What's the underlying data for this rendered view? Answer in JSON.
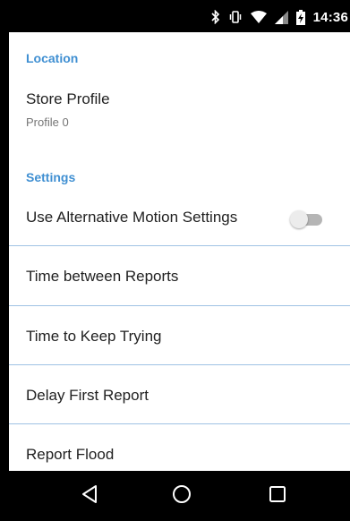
{
  "status_bar": {
    "time": "14:36",
    "icons": [
      "bluetooth-icon",
      "vibrate-icon",
      "wifi-icon",
      "cell-signal-icon",
      "battery-charging-icon"
    ]
  },
  "location_section": {
    "header": "Location",
    "store_profile": {
      "title": "Store Profile",
      "summary": "Profile 0"
    }
  },
  "settings_section": {
    "header": "Settings",
    "items": [
      {
        "title": "Use Alternative Motion Settings",
        "has_toggle": true,
        "toggle_on": false
      },
      {
        "title": "Time between Reports"
      },
      {
        "title": "Time to Keep Trying"
      },
      {
        "title": "Delay First Report"
      },
      {
        "title": "Report Flood"
      }
    ]
  },
  "nav_bar": {
    "buttons": [
      "back-icon",
      "home-icon",
      "recents-icon"
    ]
  },
  "colors": {
    "accent": "#3f8fd2",
    "divider": "#9fc2e4",
    "text_primary": "#212121",
    "text_secondary": "#757575",
    "bars": "#000000"
  }
}
